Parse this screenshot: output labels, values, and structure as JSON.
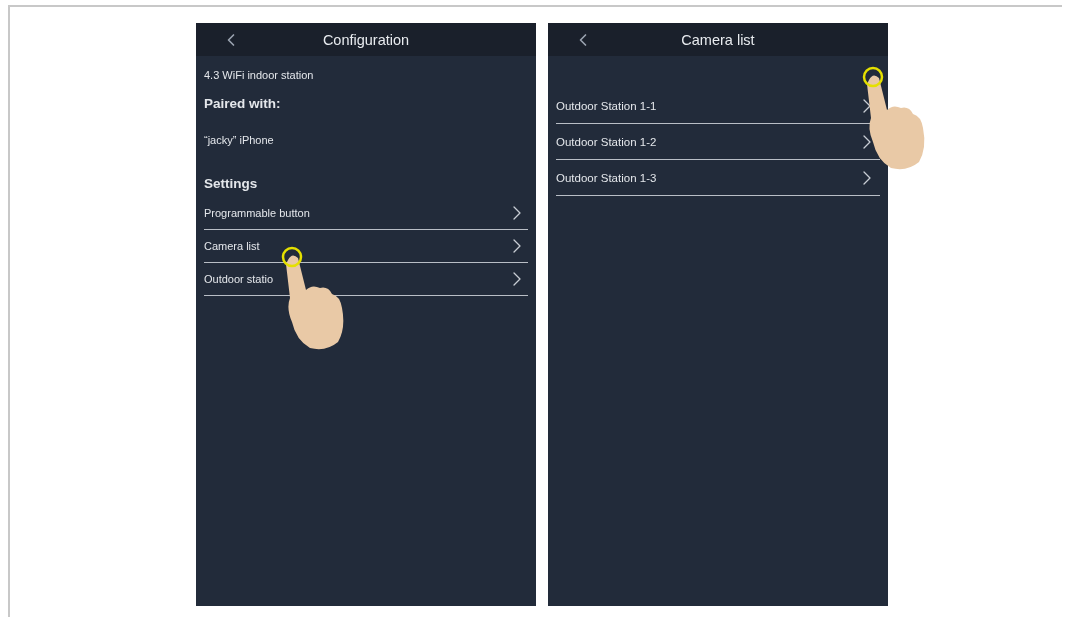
{
  "configuration_screen": {
    "title": "Configuration",
    "device": "4.3 WiFi indoor station",
    "paired_heading": "Paired with:",
    "paired_device": "“jacky” iPhone",
    "settings_heading": "Settings",
    "items": [
      {
        "label": "Programmable button"
      },
      {
        "label": "Camera list"
      },
      {
        "label": "Outdoor statio"
      }
    ]
  },
  "camera_list_screen": {
    "title": "Camera list",
    "items": [
      {
        "label": "Outdoor Station 1-1"
      },
      {
        "label": "Outdoor Station 1-2"
      },
      {
        "label": "Outdoor Station 1-3"
      }
    ]
  }
}
